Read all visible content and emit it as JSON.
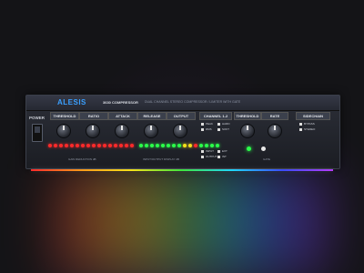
{
  "header": {
    "brand": "ALESIS",
    "model": "3630 COMPRESSOR",
    "subtitle": "DUAL CHANNEL STEREO COMPRESSOR / LIMITER WITH GATE"
  },
  "power": {
    "label": "POWER"
  },
  "sections": [
    {
      "label": "THRESHOLD"
    },
    {
      "label": "RATIO"
    },
    {
      "label": "ATTACK"
    },
    {
      "label": "RELEASE"
    },
    {
      "label": "OUTPUT"
    },
    {
      "label": "CHANNEL 1-2"
    },
    {
      "label": "THRESHOLD"
    },
    {
      "label": "RATE"
    },
    {
      "label": "SIDECHAIN"
    }
  ],
  "meters": {
    "gain": "GAIN REDUCTION dB",
    "io": "INPUT/OUTPUT DISPLAY dB"
  },
  "gate": {
    "label": "GATE"
  },
  "toggles": [
    {
      "label": "PEAK"
    },
    {
      "label": "RMS"
    },
    {
      "label": "HARD"
    },
    {
      "label": "SOFT"
    },
    {
      "label": "INPUT"
    },
    {
      "label": "OUTPUT"
    },
    {
      "label": "EXT"
    },
    {
      "label": "INT"
    }
  ],
  "sidechain": {
    "labels": [
      "BYPASS",
      "STEREO"
    ]
  },
  "colors": {
    "accent": "#3aa0ff",
    "red": "#ff2a2a",
    "green": "#2bff4a",
    "yellow": "#f4e11a"
  }
}
